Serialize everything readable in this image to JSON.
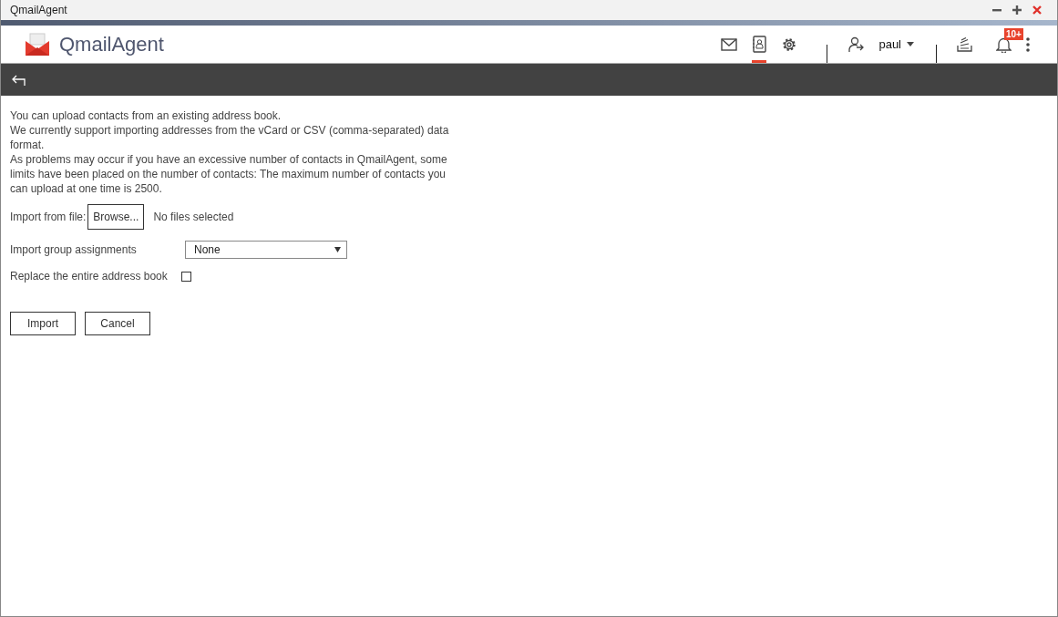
{
  "window": {
    "title": "QmailAgent"
  },
  "app": {
    "name": "QmailAgent"
  },
  "nav": [
    {
      "kind": "mail",
      "selected": false
    },
    {
      "kind": "contacts",
      "selected": true
    },
    {
      "kind": "settings",
      "selected": false
    }
  ],
  "user": {
    "name": "paul"
  },
  "notifications": {
    "badge": "10+"
  },
  "intro": [
    "You can upload contacts from an existing address book.",
    "We currently support importing addresses from the vCard or CSV (comma-separated) data format.",
    "As problems may occur if you have an excessive number of contacts in QmailAgent, some limits have been placed on the number of contacts: The maximum number of contacts you can upload at one time is 2500."
  ],
  "file": {
    "label": "Import from file:",
    "button": "Browse...",
    "status": "No files selected"
  },
  "group": {
    "label": "Import group assignments",
    "value": "None"
  },
  "replace": {
    "label": "Replace the entire address book",
    "checked": false
  },
  "buttons": [
    "Import",
    "Cancel"
  ]
}
